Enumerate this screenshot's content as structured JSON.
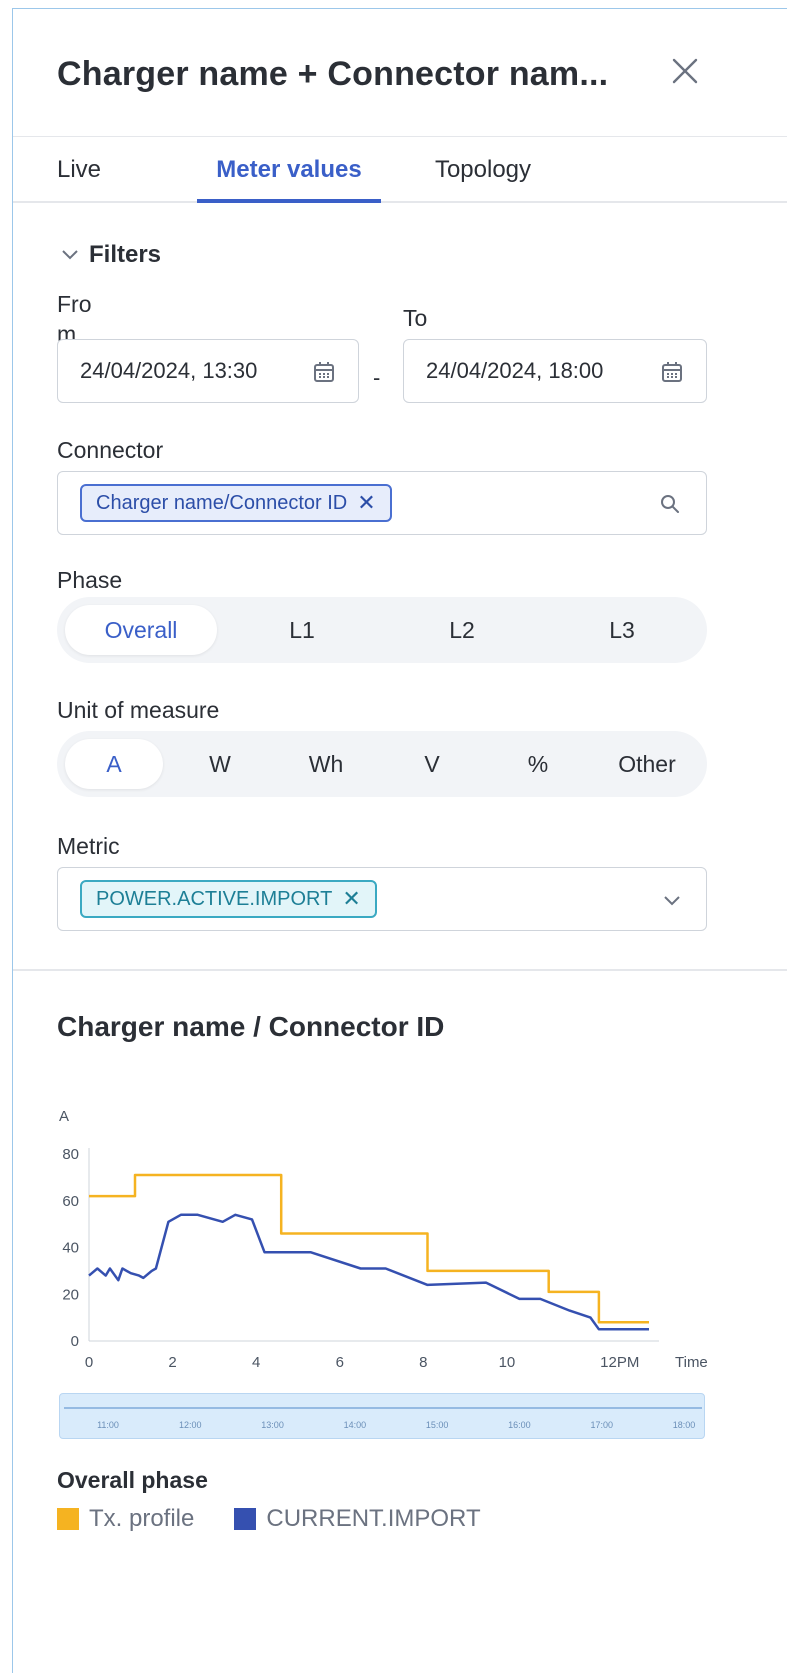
{
  "header": {
    "title": "Charger name +  Connector nam..."
  },
  "tabs": [
    {
      "label": "Live",
      "active": false
    },
    {
      "label": "Meter values",
      "active": true
    },
    {
      "label": "Topology",
      "active": false
    }
  ],
  "filters": {
    "toggle_label": "Filters",
    "from_label": "From",
    "to_label": "To",
    "from_value": "24/04/2024, 13:30",
    "to_value": "24/04/2024, 18:00",
    "range_separator": "-",
    "connector_label": "Connector",
    "connector_chip": "Charger name/Connector ID",
    "phase_label": "Phase",
    "phase_options": [
      "Overall",
      "L1",
      "L2",
      "L3"
    ],
    "phase_selected": "Overall",
    "unit_label": "Unit of measure",
    "unit_options": [
      "A",
      "W",
      "Wh",
      "V",
      "%",
      "Other"
    ],
    "unit_selected": "A",
    "metric_label": "Metric",
    "metric_chip": "POWER.ACTIVE.IMPORT"
  },
  "chart_section": {
    "title": "Charger name / Connector ID",
    "legend_title": "Overall phase",
    "navigator_ticks": [
      "11:00",
      "12:00",
      "13:00",
      "14:00",
      "15:00",
      "16:00",
      "17:00",
      "18:00"
    ]
  },
  "chart_data": {
    "type": "line",
    "ylabel": "A",
    "xlabel": "Time",
    "ylim": [
      0,
      80
    ],
    "xlim": [
      0,
      13.4
    ],
    "y_ticks": [
      0,
      20,
      40,
      60,
      80
    ],
    "x_ticks": [
      {
        "value": 0,
        "label": "0"
      },
      {
        "value": 2,
        "label": "2"
      },
      {
        "value": 4,
        "label": "4"
      },
      {
        "value": 6,
        "label": "6"
      },
      {
        "value": 8,
        "label": "8"
      },
      {
        "value": 10,
        "label": "10"
      },
      {
        "value": 12.7,
        "label": "12PM"
      }
    ],
    "series": [
      {
        "name": "Tx. profile",
        "color": "#f5b321",
        "step": true,
        "points": [
          [
            0,
            62
          ],
          [
            1.1,
            62
          ],
          [
            1.1,
            71
          ],
          [
            4.6,
            71
          ],
          [
            4.6,
            46
          ],
          [
            8.1,
            46
          ],
          [
            8.1,
            30
          ],
          [
            11.0,
            30
          ],
          [
            11.0,
            21
          ],
          [
            12.2,
            21
          ],
          [
            12.2,
            8
          ],
          [
            13.4,
            8
          ]
        ]
      },
      {
        "name": "CURRENT.IMPORT",
        "color": "#3550b0",
        "step": false,
        "points": [
          [
            0,
            28
          ],
          [
            0.2,
            31
          ],
          [
            0.4,
            28
          ],
          [
            0.5,
            31
          ],
          [
            0.7,
            26
          ],
          [
            0.8,
            31
          ],
          [
            1.0,
            29
          ],
          [
            1.2,
            28
          ],
          [
            1.3,
            27
          ],
          [
            1.5,
            30
          ],
          [
            1.6,
            31
          ],
          [
            1.9,
            51
          ],
          [
            2.2,
            54
          ],
          [
            2.6,
            54
          ],
          [
            3.2,
            51
          ],
          [
            3.5,
            54
          ],
          [
            3.9,
            52
          ],
          [
            4.2,
            38
          ],
          [
            5.3,
            38
          ],
          [
            6.5,
            31
          ],
          [
            7.1,
            31
          ],
          [
            8.1,
            24
          ],
          [
            9.5,
            25
          ],
          [
            10.3,
            18
          ],
          [
            10.8,
            18
          ],
          [
            11.5,
            13
          ],
          [
            12.0,
            10
          ],
          [
            12.2,
            5
          ],
          [
            13.4,
            5
          ]
        ]
      }
    ],
    "legend_position": "bottom-left",
    "grid": false
  },
  "colors": {
    "accent": "#3a5fc8",
    "tx_profile": "#f5b321",
    "current_import": "#3550b0"
  }
}
